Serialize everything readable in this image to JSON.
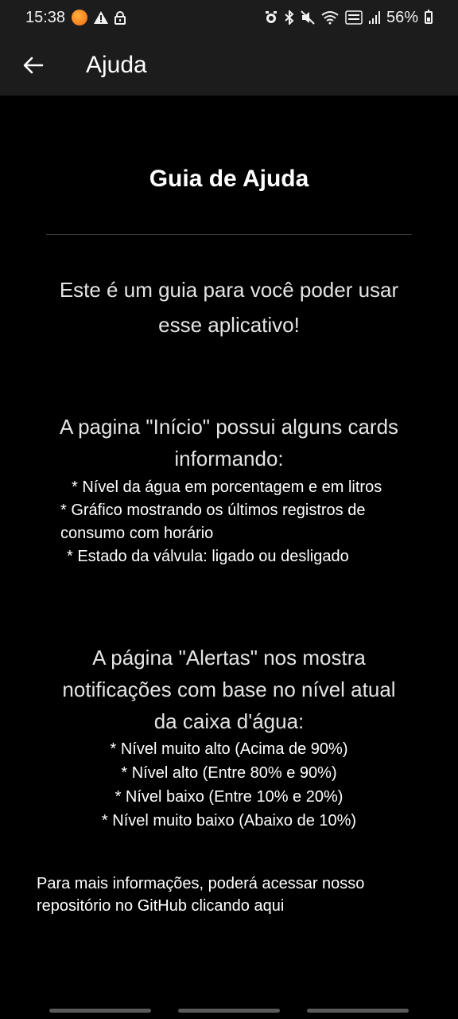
{
  "status_bar": {
    "time": "15:38",
    "battery_percent": "56%"
  },
  "app_bar": {
    "title": "Ajuda"
  },
  "content": {
    "guide_title": "Guia de Ajuda",
    "intro": "Este é um guia para você poder usar esse aplicativo!",
    "inicio": {
      "heading": "A pagina \"Início\" possui alguns cards informando:",
      "items": [
        "* Nível da água em porcentagem e em litros",
        "* Gráfico mostrando os últimos registros de consumo com horário",
        "* Estado da válvula: ligado ou desligado"
      ]
    },
    "alertas": {
      "heading": "A página \"Alertas\" nos mostra notificações com base no nível atual da caixa d'água:",
      "items": [
        "* Nível muito alto (Acima de 90%)",
        "* Nível alto (Entre 80% e 90%)",
        "* Nível baixo (Entre 10% e 20%)",
        "* Nível muito baixo (Abaixo de 10%)"
      ]
    },
    "footer": "Para mais informações, poderá acessar nosso repositório no GitHub clicando aqui"
  }
}
